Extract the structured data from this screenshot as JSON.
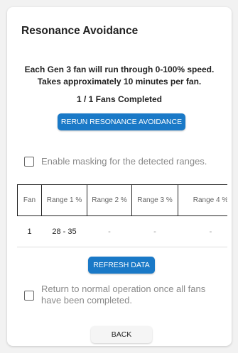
{
  "card": {
    "title": "Resonance Avoidance",
    "description_line1": "Each Gen 3 fan will run through 0-100% speed.",
    "description_line2": "Takes approximately 10 minutes per fan.",
    "status": "1 / 1 Fans Completed",
    "rerun_button": "RERUN RESONANCE AVOIDANCE",
    "masking_label": "Enable masking for the detected ranges.",
    "masking_checked": false,
    "table": {
      "headers": [
        "Fan",
        "Range 1 %",
        "Range 2 %",
        "Range 3 %",
        "Range 4 %"
      ],
      "rows": [
        [
          "1",
          "28 - 35",
          "-",
          "-",
          "-"
        ]
      ]
    },
    "refresh_button": "REFRESH DATA",
    "return_label": "Return to normal operation once all fans have been completed.",
    "return_checked": false,
    "back_button": "BACK"
  },
  "colors": {
    "primary": "#1a79c7",
    "background": "#f2f2f2",
    "card": "#ffffff",
    "muted_text": "#8a8a8a"
  }
}
